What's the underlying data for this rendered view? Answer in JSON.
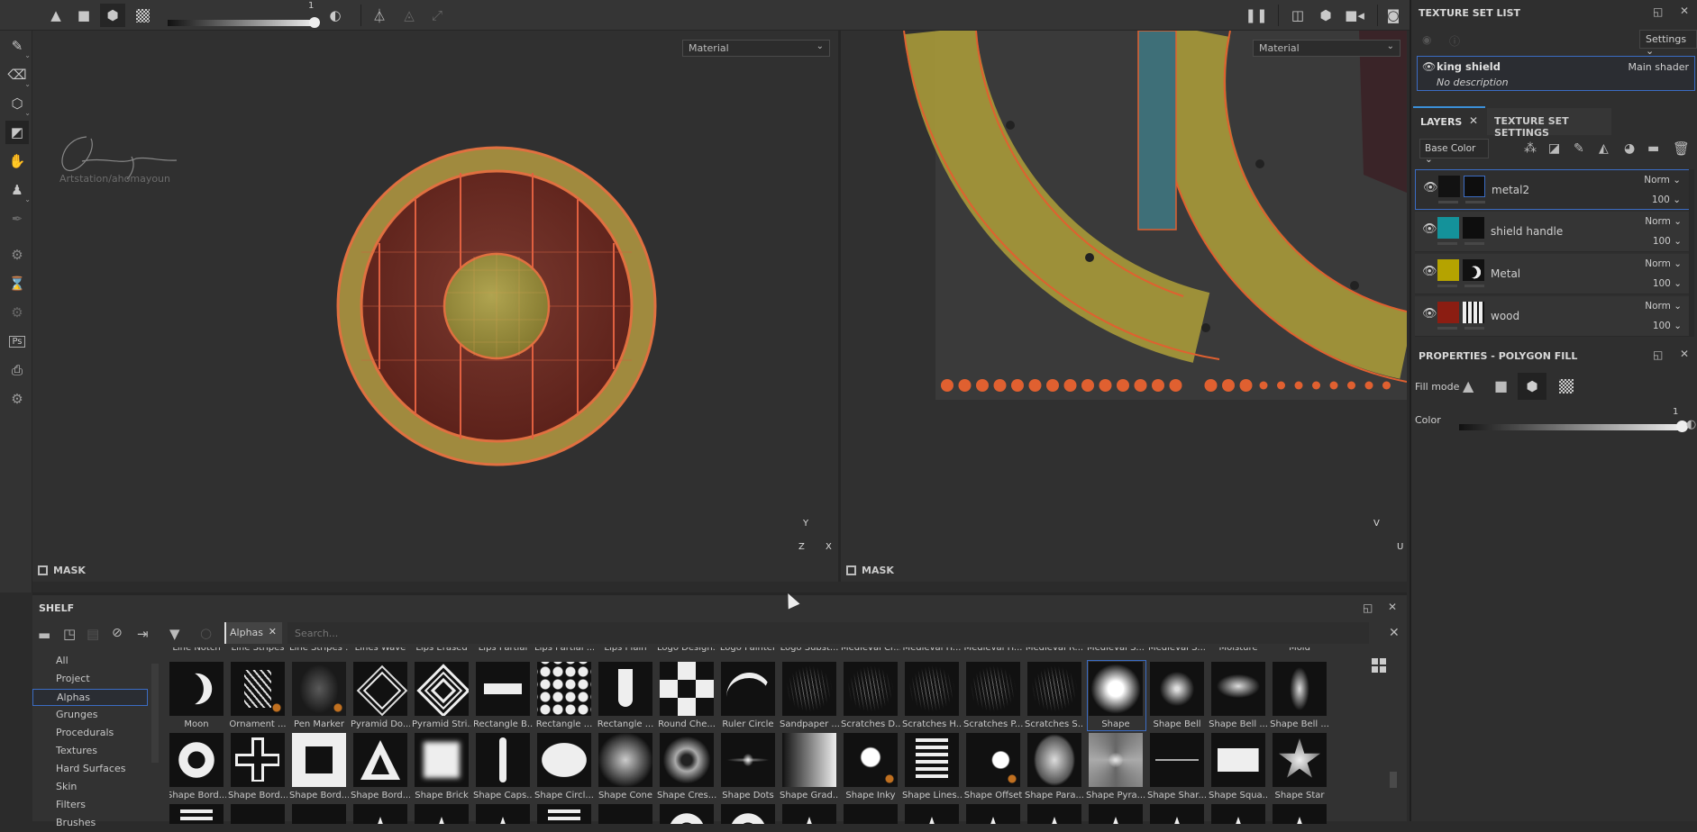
{
  "toolbar": {
    "slider_value": "1",
    "left_icons": [
      "triangle-icon",
      "square-icon",
      "cube-icon",
      "checker-icon"
    ],
    "right_icons": [
      "pause-icon",
      "split-view-icon",
      "cube-view-icon",
      "camera-video-icon",
      "screenshot-icon"
    ]
  },
  "left_tools": [
    "paint-brush-icon",
    "eraser-icon",
    "projection-icon",
    "polygon-fill-icon",
    "smudge-icon",
    "clone-stamp-icon",
    "picker-icon",
    "settings-icon",
    "bake-icon",
    "cog-icon",
    "photoshop-icon",
    "export-icon",
    "plugin-icon"
  ],
  "viewport3d": {
    "material": "Material",
    "mask_label": "MASK",
    "watermark": "Artstation/ahomayoun",
    "axes": {
      "y": "Y",
      "z": "Z",
      "x": "X"
    }
  },
  "viewport2d": {
    "material": "Material",
    "mask_label": "MASK",
    "axes": {
      "v": "V",
      "u": "U"
    }
  },
  "texture_set_list": {
    "title": "TEXTURE SET LIST",
    "settings_label": "Settings",
    "item": {
      "name": "king shield",
      "shader": "Main shader",
      "description": "No description"
    }
  },
  "layers": {
    "tabs": [
      "LAYERS",
      "TEXTURE SET SETTINGS"
    ],
    "channel": "Base Color",
    "items": [
      {
        "name": "metal2",
        "blend": "Norm",
        "opacity": "100",
        "color": "#121212",
        "selected": true
      },
      {
        "name": "shield handle",
        "blend": "Norm",
        "opacity": "100",
        "color": "#14929a",
        "selected": false
      },
      {
        "name": "Metal",
        "blend": "Norm",
        "opacity": "100",
        "color": "#b5a300",
        "selected": false
      },
      {
        "name": "wood",
        "blend": "Norm",
        "opacity": "100",
        "color": "#8b1d12",
        "selected": false
      }
    ]
  },
  "properties": {
    "title": "PROPERTIES - POLYGON FILL",
    "fill_mode_label": "Fill mode",
    "color_label": "Color",
    "color_value": "1"
  },
  "shelf": {
    "title": "SHELF",
    "filter_tag": "Alphas",
    "search_placeholder": "Search...",
    "categories": [
      "All",
      "Project",
      "Alphas",
      "Grunges",
      "Procedurals",
      "Textures",
      "Hard Surfaces",
      "Skin",
      "Filters",
      "Brushes"
    ],
    "selected_category": "Alphas",
    "row0_labels": [
      "Line Notch",
      "Line Stripes",
      "Line Stripes ...",
      "Lines Wave",
      "Lips Erased",
      "Lips Partial",
      "Lips Partial ...",
      "Lips Plain",
      "Logo Design...",
      "Logo Painter",
      "Logo Subst...",
      "Medieval Cr...",
      "Medieval H...",
      "Medieval H...",
      "Medieval R...",
      "Medieval S...",
      "Medieval S...",
      "Moisture",
      "Mold"
    ],
    "row1": [
      {
        "label": "Moon",
        "thumb": "moon"
      },
      {
        "label": "Ornament ...",
        "thumb": "orn"
      },
      {
        "label": "Pen Marker",
        "thumb": "blur"
      },
      {
        "label": "Pyramid Do...",
        "thumb": "diam"
      },
      {
        "label": "Pyramid Stri...",
        "thumb": "cdiam"
      },
      {
        "label": "Rectangle B...",
        "thumb": "trap"
      },
      {
        "label": "Rectangle ...",
        "thumb": "dots"
      },
      {
        "label": "Rectangle ...",
        "thumb": "ucap"
      },
      {
        "label": "Round Che...",
        "thumb": "check"
      },
      {
        "label": "Ruler Circle",
        "thumb": "arc"
      },
      {
        "label": "Sandpaper ...",
        "thumb": "scr"
      },
      {
        "label": "Scratches D...",
        "thumb": "scr"
      },
      {
        "label": "Scratches H...",
        "thumb": "scr"
      },
      {
        "label": "Scratches P...",
        "thumb": "scr"
      },
      {
        "label": "Scratches S...",
        "thumb": "scr"
      },
      {
        "label": "Shape",
        "thumb": "soft",
        "selected": true
      },
      {
        "label": "Shape Bell",
        "thumb": "bell"
      },
      {
        "label": "Shape Bell ...",
        "thumb": "bellh"
      },
      {
        "label": "Shape Bell ...",
        "thumb": "bellv"
      }
    ],
    "row2": [
      {
        "label": "Shape Bord...",
        "thumb": "ring"
      },
      {
        "label": "Shape Bord...",
        "thumb": "cross"
      },
      {
        "label": "Shape Bord...",
        "thumb": "sqb"
      },
      {
        "label": "Shape Bord...",
        "thumb": "tri"
      },
      {
        "label": "Shape Brick",
        "thumb": "srect"
      },
      {
        "label": "Shape Caps...",
        "thumb": "capv"
      },
      {
        "label": "Shape Circl...",
        "thumb": "ell"
      },
      {
        "label": "Shape Cone",
        "thumb": "cone"
      },
      {
        "label": "Shape Cres...",
        "thumb": "cres"
      },
      {
        "label": "Shape Dots",
        "thumb": "dline"
      },
      {
        "label": "Shape Grad...",
        "thumb": "grad"
      },
      {
        "label": "Shape Inky",
        "thumb": "inky"
      },
      {
        "label": "Shape Lines...",
        "thumb": "lines"
      },
      {
        "label": "Shape Offset",
        "thumb": "off"
      },
      {
        "label": "Shape Para...",
        "thumb": "para"
      },
      {
        "label": "Shape Pyra...",
        "thumb": "pyr"
      },
      {
        "label": "Shape Shar...",
        "thumb": "thin"
      },
      {
        "label": "Shape Squa...",
        "thumb": "rect"
      },
      {
        "label": "Shape Star",
        "thumb": "star"
      }
    ],
    "row3_thumbs": [
      "lines",
      "dark",
      "dark",
      "trio",
      "trio",
      "trio",
      "lines",
      "dark",
      "ring",
      "ring",
      "trio",
      "dark",
      "trio",
      "trio",
      "trio",
      "trio",
      "trio",
      "trio",
      "trio"
    ]
  }
}
